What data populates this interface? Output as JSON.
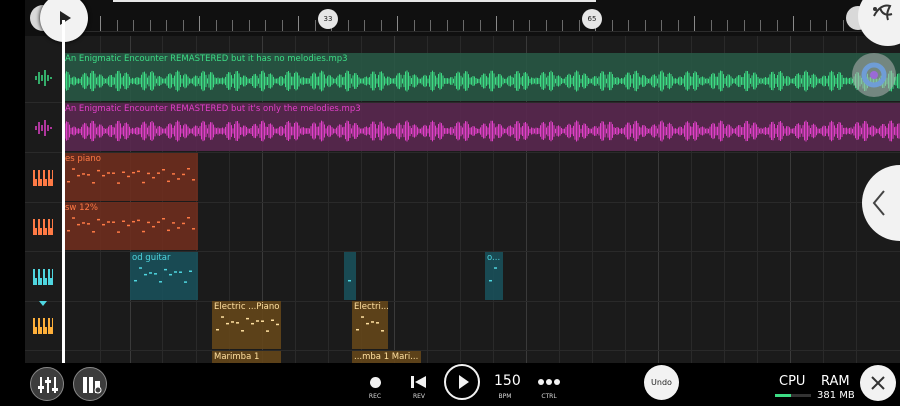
{
  "ruler": {
    "markers": [
      "33",
      "65"
    ]
  },
  "tracks": [
    {
      "icon": "waveform-icon",
      "color": "#3ddc84",
      "clips": [
        {
          "label": "An Enigmatic Encounter REMASTERED but it has no melodies.mp3"
        }
      ]
    },
    {
      "icon": "waveform-icon",
      "color": "#e040c8",
      "clips": [
        {
          "label": "An Enigmatic Encounter REMASTERED but it's only the melodies.mp3"
        }
      ]
    },
    {
      "icon": "piano-icon",
      "color": "#ff7a45",
      "clips": [
        {
          "label": "es piano"
        }
      ]
    },
    {
      "icon": "piano-icon",
      "color": "#ff7a45",
      "clips": [
        {
          "label": "sw 12%"
        }
      ]
    },
    {
      "icon": "piano-icon",
      "color": "#4fd6e0",
      "clips": [
        {
          "label": "od guitar"
        },
        {
          "label": ""
        },
        {
          "label": "o..."
        }
      ]
    },
    {
      "icon": "piano-icon",
      "color": "#ffb03a",
      "clips": [
        {
          "label": "Electric ...Piano"
        },
        {
          "label": "Electri..."
        }
      ]
    },
    {
      "icon": "",
      "color": "#ffb03a",
      "clips": [
        {
          "label": "Marimba 1"
        },
        {
          "label": "...mba 1 Mari..."
        }
      ]
    }
  ],
  "transport": {
    "rec_label": "REC",
    "rev_label": "REV",
    "bpm_value": "150",
    "bpm_label": "BPM",
    "ctrl_label": "CTRL",
    "undo_label": "Undo",
    "cpu_label": "CPU",
    "ram_label": "RAM",
    "ram_value": "381 MB"
  },
  "colors": {
    "background": "#1b1b1b",
    "playhead": "#ffffff"
  }
}
